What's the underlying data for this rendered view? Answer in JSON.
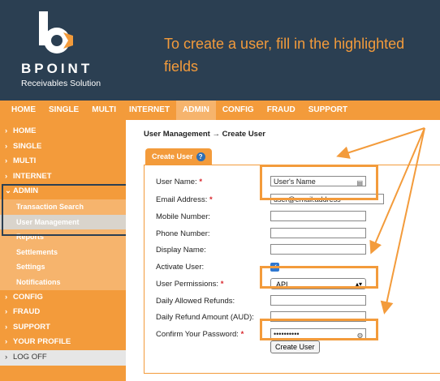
{
  "brand": {
    "name": "BPOINT",
    "subtitle": "Receivables Solution"
  },
  "headline": "To create a user, fill in the highlighted fields",
  "top_nav": [
    "HOME",
    "SINGLE",
    "MULTI",
    "INTERNET",
    "ADMIN",
    "CONFIG",
    "FRAUD",
    "SUPPORT"
  ],
  "sidebar": {
    "items": [
      "HOME",
      "SINGLE",
      "MULTI",
      "INTERNET",
      "ADMIN"
    ],
    "admin_sub": [
      "Transaction Search",
      "User Management",
      "Reports",
      "Settlements",
      "Settings",
      "Notifications"
    ],
    "items_after": [
      "CONFIG",
      "FRAUD",
      "SUPPORT",
      "YOUR PROFILE"
    ],
    "logoff": "LOG OFF"
  },
  "page": {
    "title": "User Management → Create User",
    "tab": "Create User",
    "tab_help": "?"
  },
  "form": {
    "username_label": "User Name:",
    "username_value": "User's Name",
    "email_label": "Email Address:",
    "email_value": "user@email.address",
    "mobile_label": "Mobile Number:",
    "phone_label": "Phone Number:",
    "display_label": "Display Name:",
    "activate_label": "Activate User:",
    "activate_checked": true,
    "permissions_label": "User Permissions:",
    "permissions_value": "API",
    "refunds_label": "Daily Allowed Refunds:",
    "refund_amount_label": "Daily Refund Amount (AUD):",
    "confirm_label": "Confirm Your Password:",
    "confirm_value": "••••••••••",
    "required_mark": "*",
    "submit_label": "Create User"
  },
  "colors": {
    "accent": "#f39b3b",
    "header_bg": "#2b3f52",
    "required": "#d9262c"
  }
}
